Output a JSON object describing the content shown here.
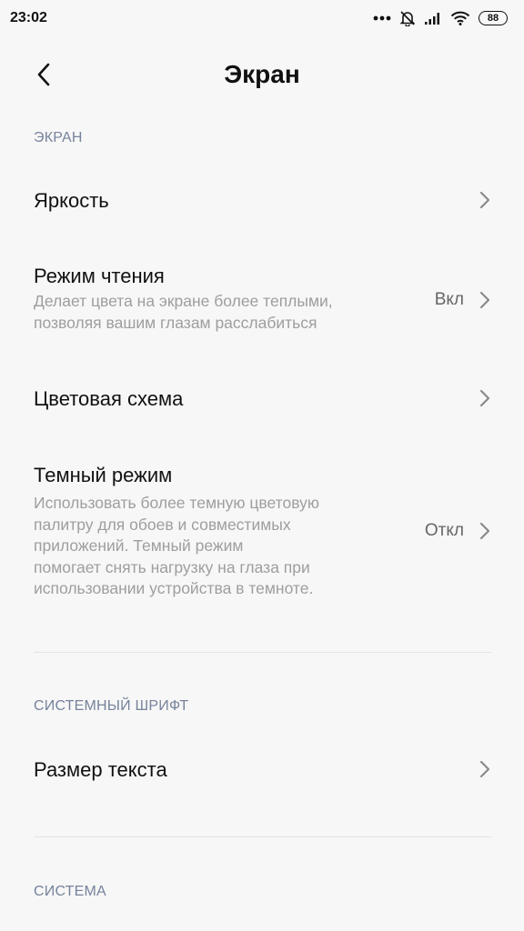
{
  "status_bar": {
    "time": "23:02",
    "battery": "88",
    "icons": [
      "more-dots-icon",
      "alarm-off-icon",
      "signal-icon",
      "wifi-icon",
      "battery-icon"
    ]
  },
  "app_bar": {
    "back_icon": "chevron-left-icon",
    "title": "Экран"
  },
  "sections": {
    "screen": {
      "header": "ЭКРАН",
      "items": {
        "brightness": {
          "title": "Яркость"
        },
        "reading_mode": {
          "title": "Режим чтения",
          "subtitle_lines": [
            "Делает цвета на экране более теплыми,",
            "позволяя вашим глазам расслабиться"
          ],
          "value": "Вкл"
        },
        "color_scheme": {
          "title": "Цветовая схема"
        },
        "dark_mode": {
          "title": "Темный режим",
          "subtitle_lines": [
            "Использовать более темную цветовую",
            "палитру для обоев и совместимых",
            "приложений. Темный режим",
            "помогает снять нагрузку на глаза при",
            "использовании устройства в темноте."
          ],
          "value": "Откл"
        }
      }
    },
    "system_font": {
      "header": "СИСТЕМНЫЙ ШРИФТ",
      "items": {
        "text_size": {
          "title": "Размер текста"
        }
      }
    },
    "system": {
      "header": "СИСТЕМА"
    }
  },
  "colors": {
    "background": "#f7f7f7",
    "section_header": "#76839c",
    "subtitle": "#9e9e9e",
    "chevron": "#8a8a8a"
  }
}
